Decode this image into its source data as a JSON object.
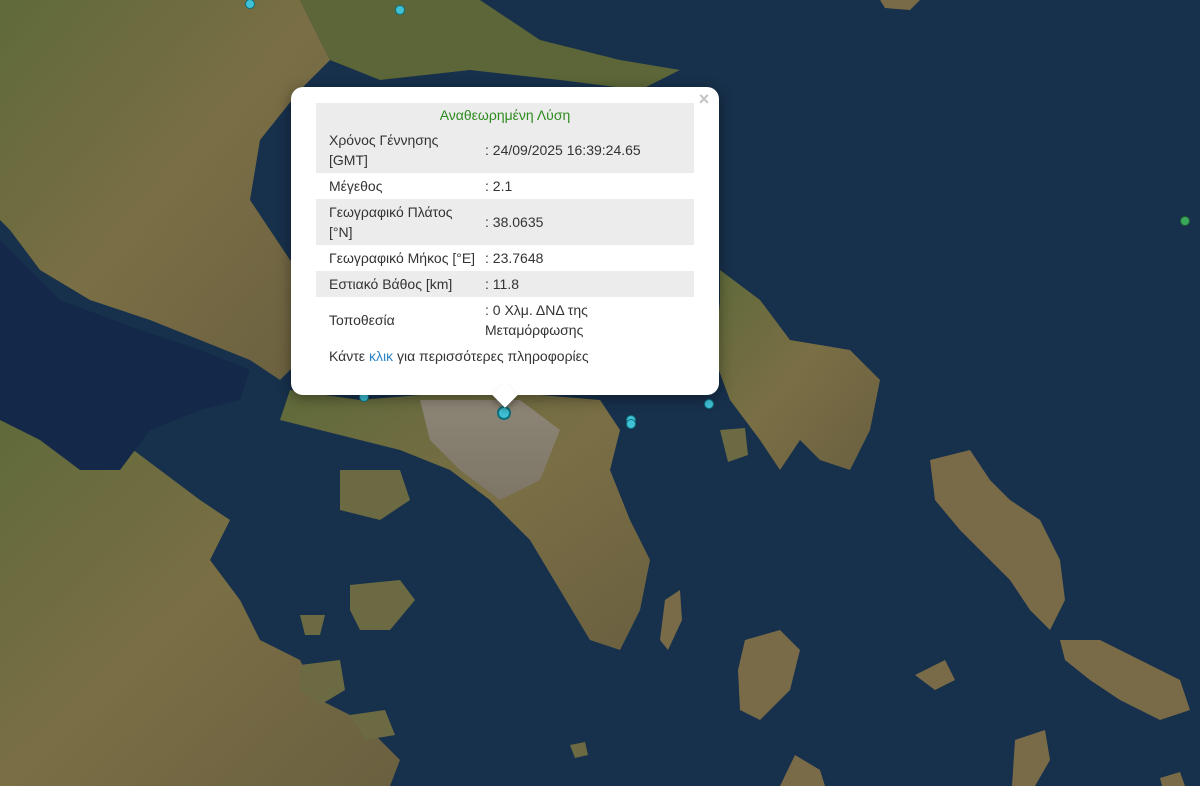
{
  "popup": {
    "header": "Αναθεωρημένη Λύση",
    "close_glyph": "×",
    "rows": [
      {
        "label": "Χρόνος Γέννησης [GMT]",
        "value": ": 24/09/2025 16:39:24.65"
      },
      {
        "label": "Μέγεθος",
        "value": ": 2.1"
      },
      {
        "label": "Γεωγραφικό Πλάτος [°N]",
        "value": ": 38.0635"
      },
      {
        "label": "Γεωγραφικό Μήκος [°E]",
        "value": ": 23.7648"
      },
      {
        "label": "Εστιακό Βάθος [km]",
        "value": ": 11.8"
      },
      {
        "label": "Τοποθεσία",
        "value": ": 0 Χλμ. ΔΝΔ της Μεταμόρφωσης"
      }
    ],
    "more": {
      "prefix": "Κάντε",
      "link": "κλικ",
      "suffix": "για περισσότερες πληροφορίες"
    }
  },
  "colors": {
    "sea": "#16304a",
    "land": "#6d6a3f",
    "marker_cyan": "#3fc1d6",
    "marker_green": "#3aa85a",
    "header_green": "#2e8b1f",
    "link_blue": "#2a87c4"
  },
  "markers": [
    {
      "name": "earthquake-marker",
      "color": "cyan"
    },
    {
      "name": "earthquake-marker",
      "color": "cyan"
    },
    {
      "name": "earthquake-marker",
      "color": "cyan"
    },
    {
      "name": "earthquake-marker",
      "color": "cyan"
    },
    {
      "name": "earthquake-marker",
      "color": "cyan"
    },
    {
      "name": "earthquake-marker",
      "color": "cyan"
    },
    {
      "name": "earthquake-marker",
      "color": "green"
    },
    {
      "name": "selected-earthquake-marker",
      "color": "cyan",
      "selected": true
    }
  ]
}
